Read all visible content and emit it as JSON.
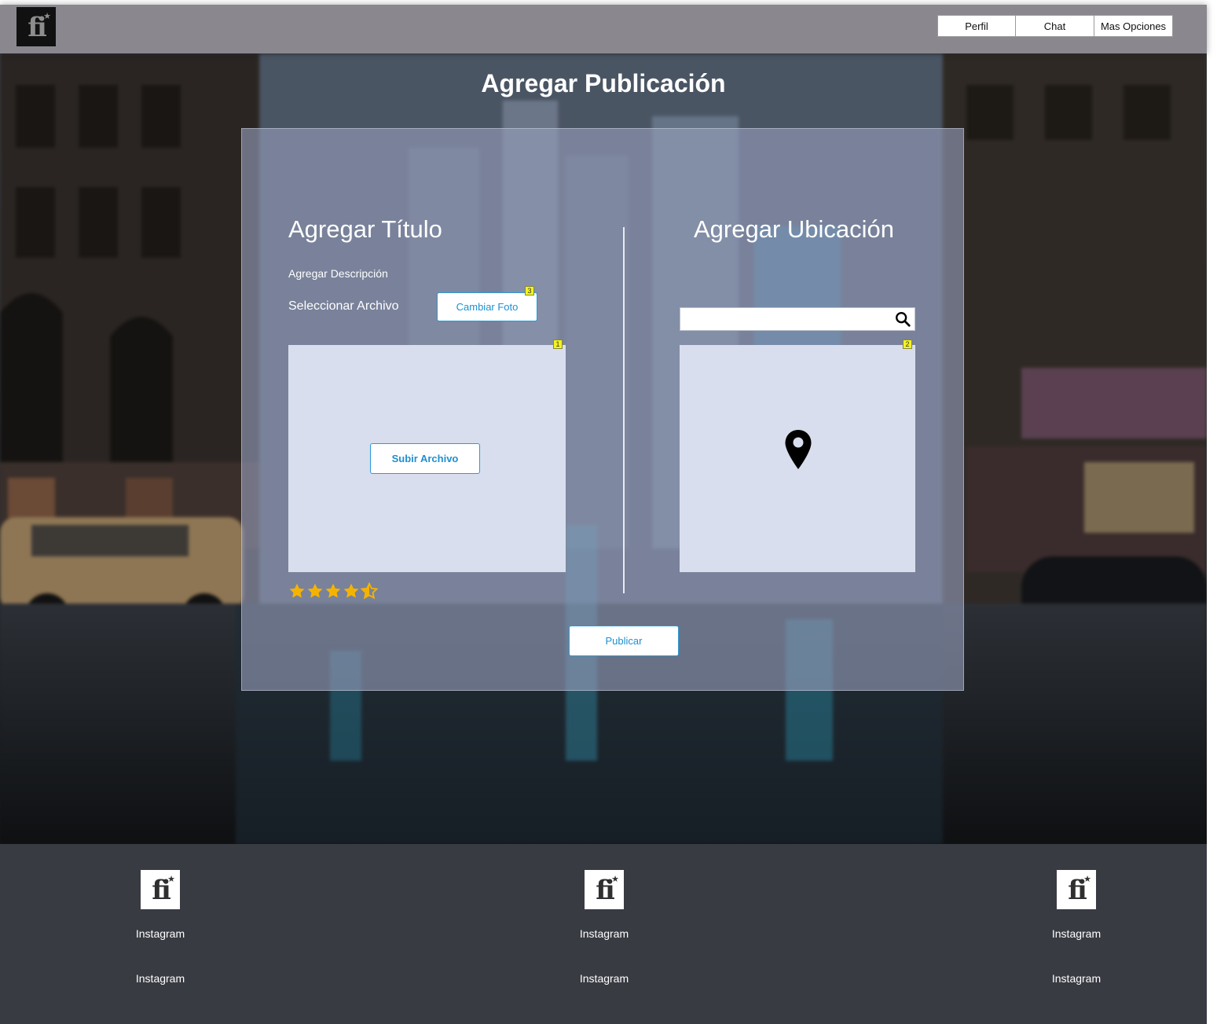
{
  "header": {
    "logo_text": "fi",
    "nav": [
      {
        "label": "Perfil"
      },
      {
        "label": "Chat"
      },
      {
        "label": "Mas Opciones"
      }
    ]
  },
  "page": {
    "title": "Agregar Publicación"
  },
  "form": {
    "title_heading": "Agregar Título",
    "description_label": "Agregar Descripción",
    "select_file_label": "Seleccionar Archivo",
    "change_photo_button": "Cambiar Foto",
    "upload_button": "Subir Archivo",
    "rating": 4.5,
    "rating_max": 5,
    "location_heading": "Agregar Ubicación",
    "search_placeholder": "",
    "publish_button": "Publicar",
    "markers": {
      "upload_box": "1",
      "map_box": "2",
      "change_photo": "3"
    }
  },
  "colors": {
    "header_bg": "#8a888e",
    "accent": "#1e8fd0",
    "star": "#f5b301",
    "footer_bg": "#393b43"
  },
  "footer": {
    "columns": [
      {
        "logo_text": "fi",
        "links": [
          "Instagram",
          "Instagram"
        ]
      },
      {
        "logo_text": "fi",
        "links": [
          "Instagram",
          "Instagram"
        ]
      },
      {
        "logo_text": "fi",
        "links": [
          "Instagram",
          "Instagram"
        ]
      }
    ]
  }
}
